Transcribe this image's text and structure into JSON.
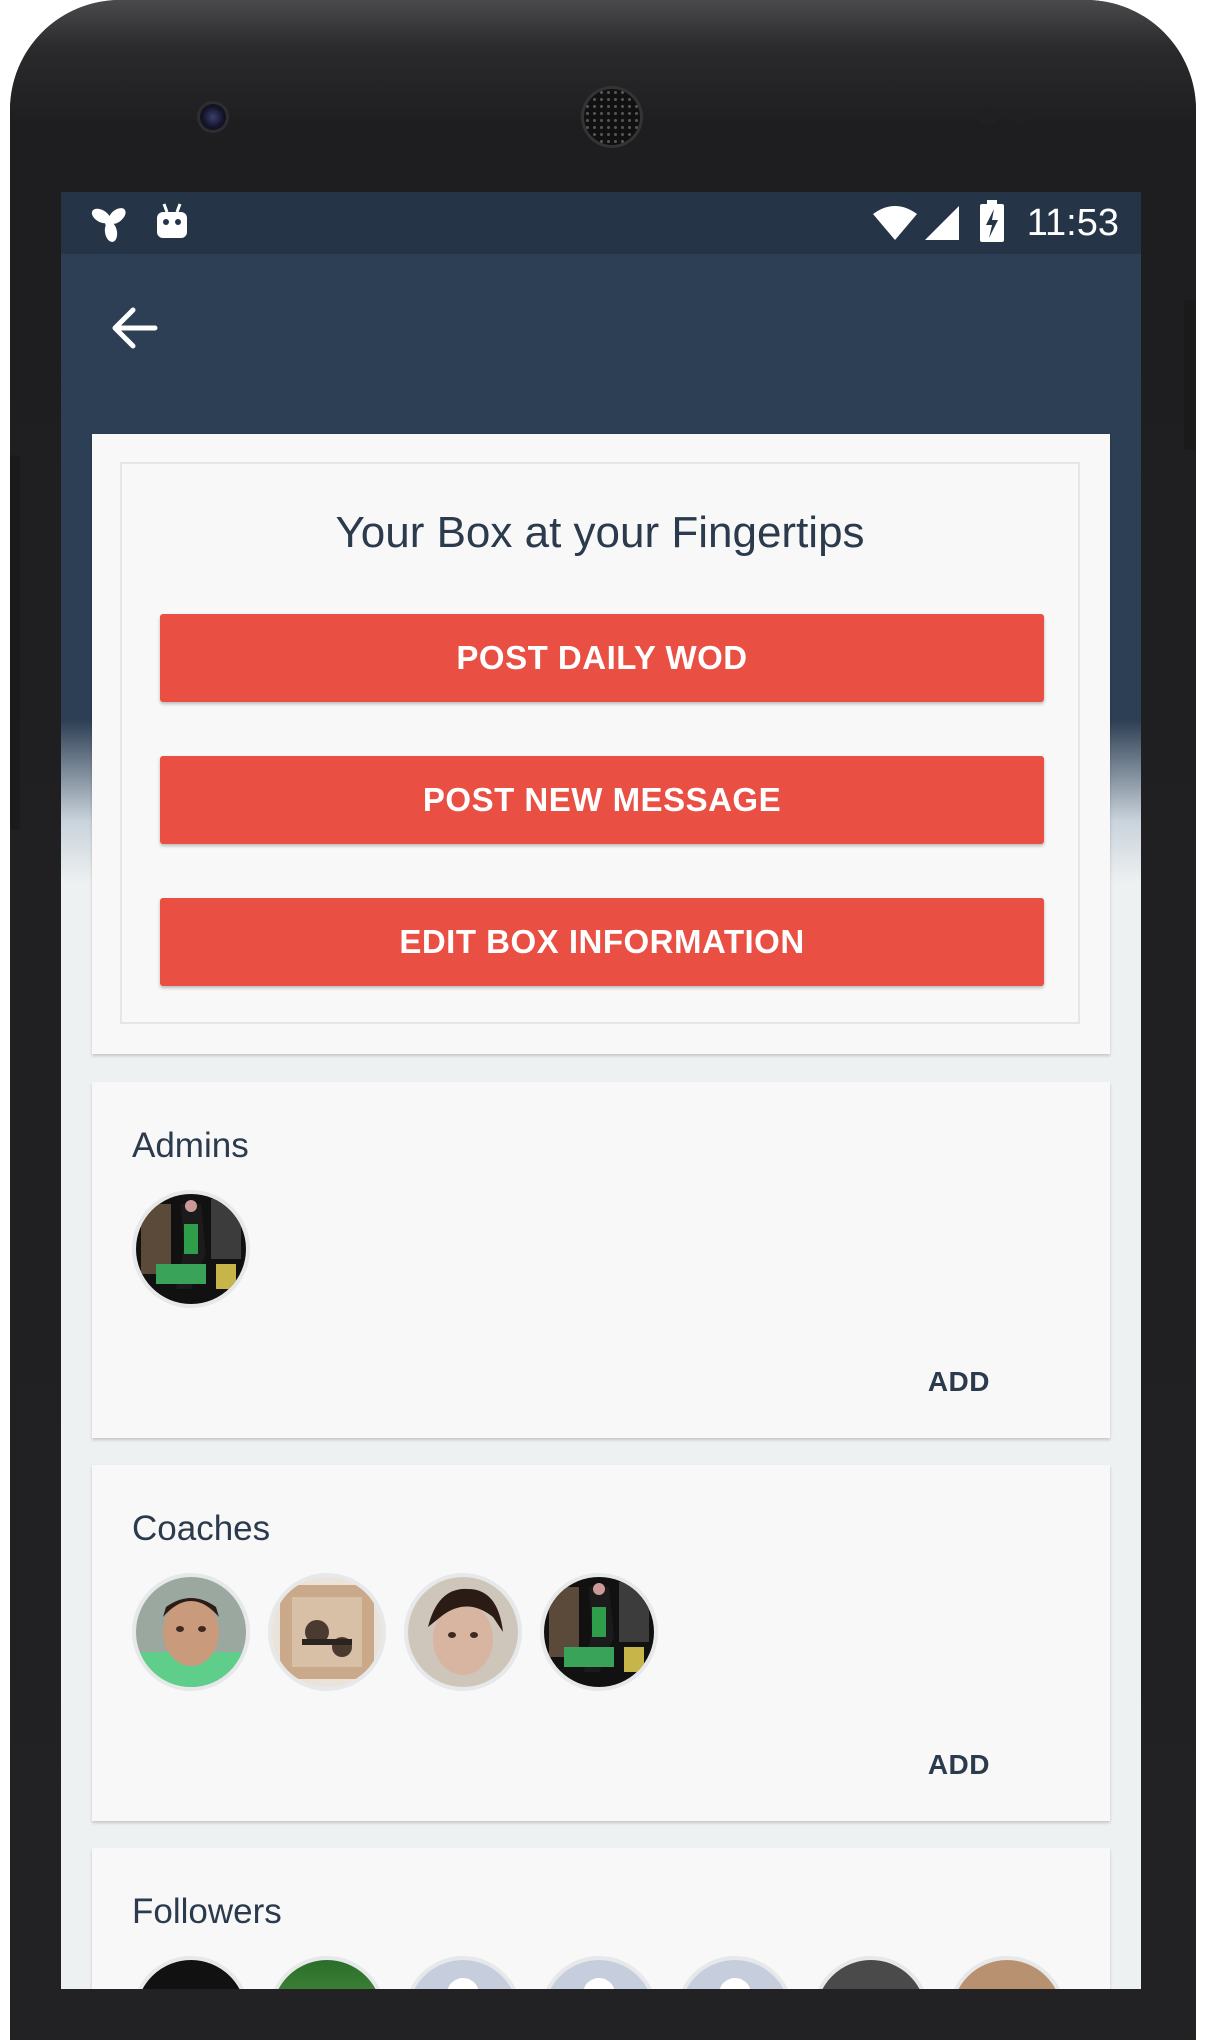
{
  "status_bar": {
    "time": "11:53",
    "icons": [
      "pinwheel-icon",
      "android-icon",
      "wifi-icon",
      "signal-icon",
      "battery-charging-icon"
    ]
  },
  "header": {
    "back_icon": "arrow-back-icon",
    "color": "#2d3f54"
  },
  "main_card": {
    "tagline": "Your Box at your Fingertips",
    "buttons": [
      {
        "label": "POST DAILY WOD"
      },
      {
        "label": "POST NEW MESSAGE"
      },
      {
        "label": "EDIT BOX INFORMATION"
      }
    ],
    "button_color": "#e94f43"
  },
  "admins": {
    "title": "Admins",
    "add_label": "ADD",
    "avatars": [
      "athlete-photo"
    ]
  },
  "coaches": {
    "title": "Coaches",
    "add_label": "ADD",
    "avatars": [
      "man-photo",
      "gym-photo",
      "woman-photo",
      "athlete-photo"
    ]
  },
  "followers": {
    "title": "Followers",
    "avatars": [
      "athlete-photo",
      "gym-photo",
      "default-user",
      "default-user",
      "default-user",
      "person-photo",
      "person-photo"
    ]
  }
}
